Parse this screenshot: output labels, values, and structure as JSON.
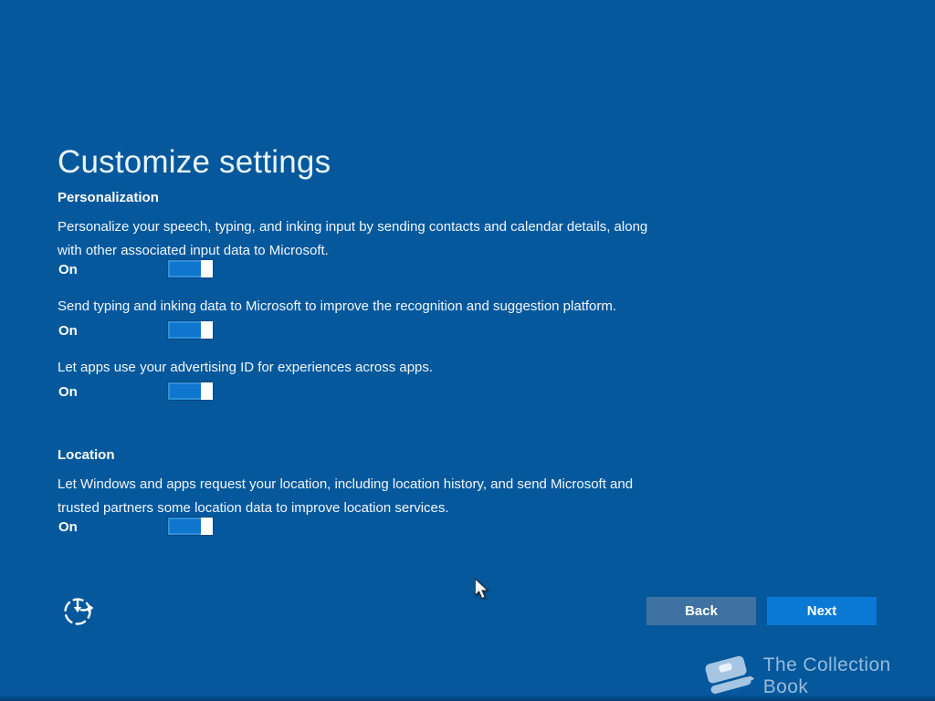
{
  "window": {
    "title": "Customize settings"
  },
  "colors": {
    "background": "#05589C",
    "next_button": "#0A79D6",
    "back_button": "#3D72A2",
    "toggle_fill": "#0E76CC",
    "toggle_border": "#2F8FD9",
    "toggle_knob": "#FFFFFF",
    "text": "#FFFFFF",
    "watermark": "#96BBDC"
  },
  "icons": {
    "ease_of_access": "dashed-circle-arrow-icon",
    "watermark_book": "book-icon",
    "pointer": "arrow-cursor-icon"
  },
  "sections": [
    {
      "heading": "Personalization",
      "settings": [
        {
          "description": "Personalize your speech, typing, and inking input by sending contacts and calendar details, along\nwith other associated input data to Microsoft.",
          "state": "On"
        },
        {
          "description": "Send typing and inking data to Microsoft to improve the recognition and suggestion platform.",
          "state": "On"
        },
        {
          "description": "Let apps use your advertising ID for experiences across apps.",
          "state": "On"
        }
      ]
    },
    {
      "heading": "Location",
      "settings": [
        {
          "description": "Let Windows and apps request your location, including location history, and send Microsoft and\ntrusted partners some location data to improve location services.",
          "state": "On"
        }
      ]
    }
  ],
  "footer": {
    "back_label": "Back",
    "next_label": "Next"
  },
  "watermark": {
    "label": "The Collection Book"
  }
}
